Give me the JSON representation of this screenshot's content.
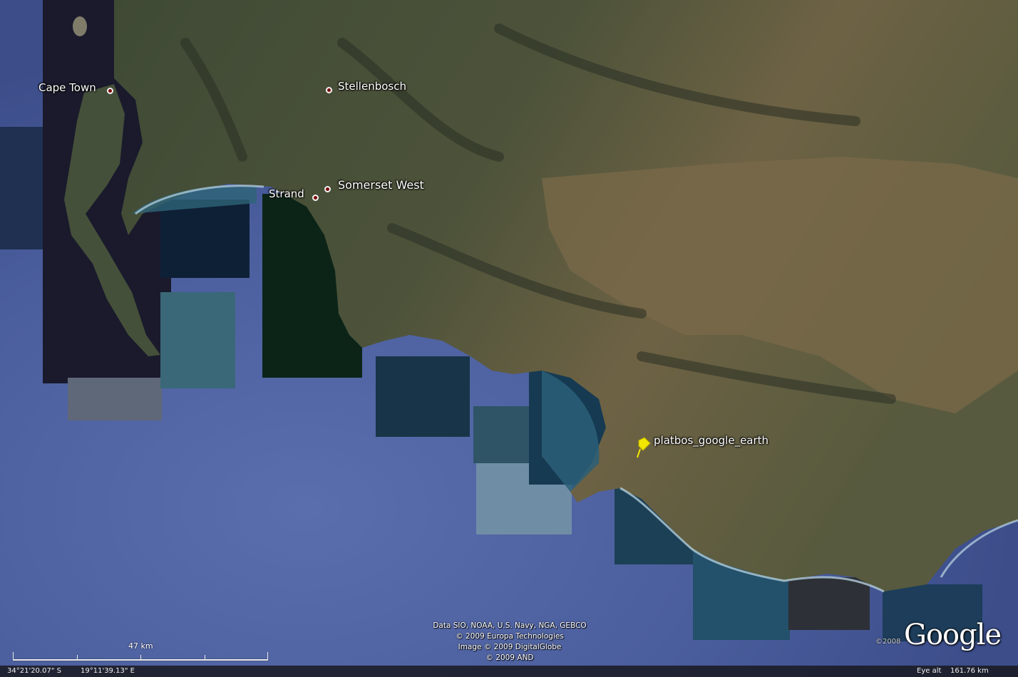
{
  "places": [
    {
      "name": "Cape Town"
    },
    {
      "name": "Stellenbosch"
    },
    {
      "name": "Strand"
    },
    {
      "name": "Somerset West"
    }
  ],
  "placemark": {
    "name": "platbos_google_earth",
    "icon": "yellow-pushpin-icon"
  },
  "attribution": [
    "Data SIO, NOAA, U.S. Navy, NGA, GEBCO",
    "© 2009 Europa Technologies",
    "Image © 2009 DigitalGlobe",
    "© 2009 AND"
  ],
  "scale_label": "47 km",
  "status": {
    "latitude": "34°21'20.07\" S",
    "longitude": "19°11'39.13\" E",
    "eye_alt_label": "Eye alt",
    "eye_alt_value": "161.76 km"
  },
  "logo_text": "Google",
  "logo_copyright": "©2008",
  "colors": {
    "ocean": "#4b5f9e",
    "land": "#4a5238",
    "marker": "#7a0a0a",
    "pin": "#f2e600"
  }
}
